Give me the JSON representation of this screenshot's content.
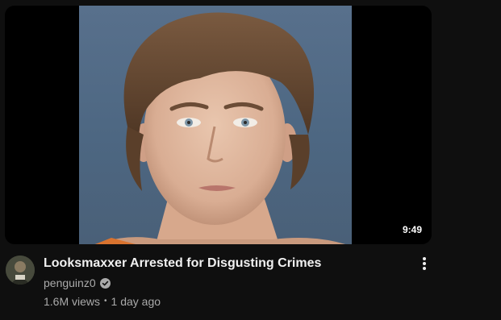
{
  "video": {
    "duration": "9:49",
    "title": "Looksmaxxer Arrested for Disgusting Crimes",
    "channel": "penguinz0",
    "views": "1.6M views",
    "separator": "•",
    "age": "1 day ago"
  },
  "icons": {
    "verified": "verified-check-icon",
    "menu": "more-vert-icon"
  },
  "colors": {
    "background": "#0f0f0f",
    "title": "#f1f1f1",
    "secondary_text": "#aaaaaa",
    "duration_bg": "#000000"
  }
}
